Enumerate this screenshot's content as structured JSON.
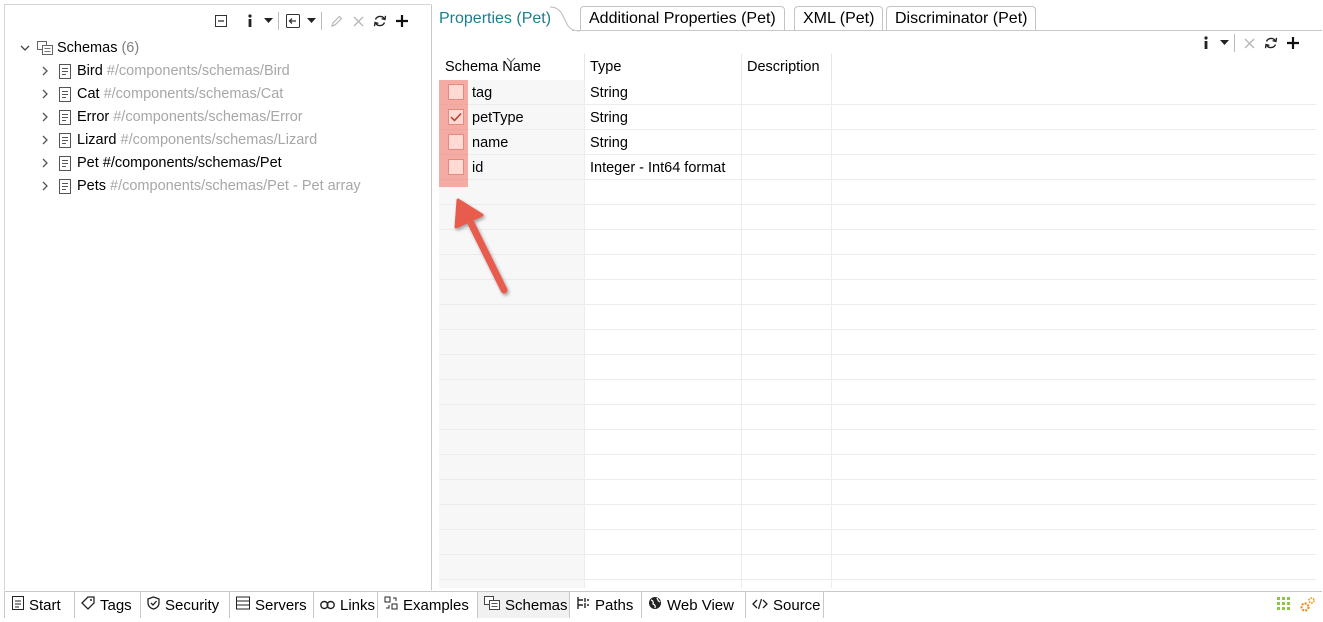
{
  "colors": {
    "accent": "#1a7f8e",
    "highlight": "#f06e5f",
    "selection": "#d9d9d9",
    "muted_text": "#a7a7a7"
  },
  "left_toolbar": {
    "icons": [
      "collapse-all-icon",
      "info-icon",
      "dropdown-icon",
      "export-icon",
      "dropdown-icon",
      "edit-icon",
      "delete-icon",
      "refresh-icon",
      "add-icon"
    ]
  },
  "tree": {
    "root": {
      "label": "Schemas",
      "count": "(6)"
    },
    "items": [
      {
        "label": "Bird",
        "path": "#/components/schemas/Bird"
      },
      {
        "label": "Cat",
        "path": "#/components/schemas/Cat"
      },
      {
        "label": "Error",
        "path": "#/components/schemas/Error"
      },
      {
        "label": "Lizard",
        "path": "#/components/schemas/Lizard"
      },
      {
        "label": "Pet",
        "path": "#/components/schemas/Pet"
      },
      {
        "label": "Pets",
        "path": "#/components/schemas/Pet - Pet array"
      }
    ],
    "selected": "Pet"
  },
  "tabs": [
    {
      "label": "Properties (Pet)",
      "active": true
    },
    {
      "label": "Additional Properties (Pet)"
    },
    {
      "label": "XML (Pet)"
    },
    {
      "label": "Discriminator (Pet)"
    }
  ],
  "table": {
    "headers": [
      "Schema Name",
      "Type",
      "Description"
    ],
    "rows": [
      {
        "name": "tag",
        "type": "String",
        "checked": false
      },
      {
        "name": "petType",
        "type": "String",
        "checked": true
      },
      {
        "name": "name",
        "type": "String",
        "checked": false
      },
      {
        "name": "id",
        "type": "Integer - Int64 format",
        "checked": false
      }
    ]
  },
  "bottom_tabs": [
    {
      "label": "Start",
      "icon": "document-icon"
    },
    {
      "label": "Tags",
      "icon": "tag-icon"
    },
    {
      "label": "Security",
      "icon": "shield-icon"
    },
    {
      "label": "Servers",
      "icon": "server-icon"
    },
    {
      "label": "Links",
      "icon": "link-icon"
    },
    {
      "label": "Examples",
      "icon": "examples-icon"
    },
    {
      "label": "Schemas",
      "icon": "schemas-icon",
      "active": true
    },
    {
      "label": "Paths",
      "icon": "paths-icon"
    },
    {
      "label": "Web View",
      "icon": "globe-icon"
    },
    {
      "label": "Source",
      "icon": "code-icon"
    }
  ]
}
